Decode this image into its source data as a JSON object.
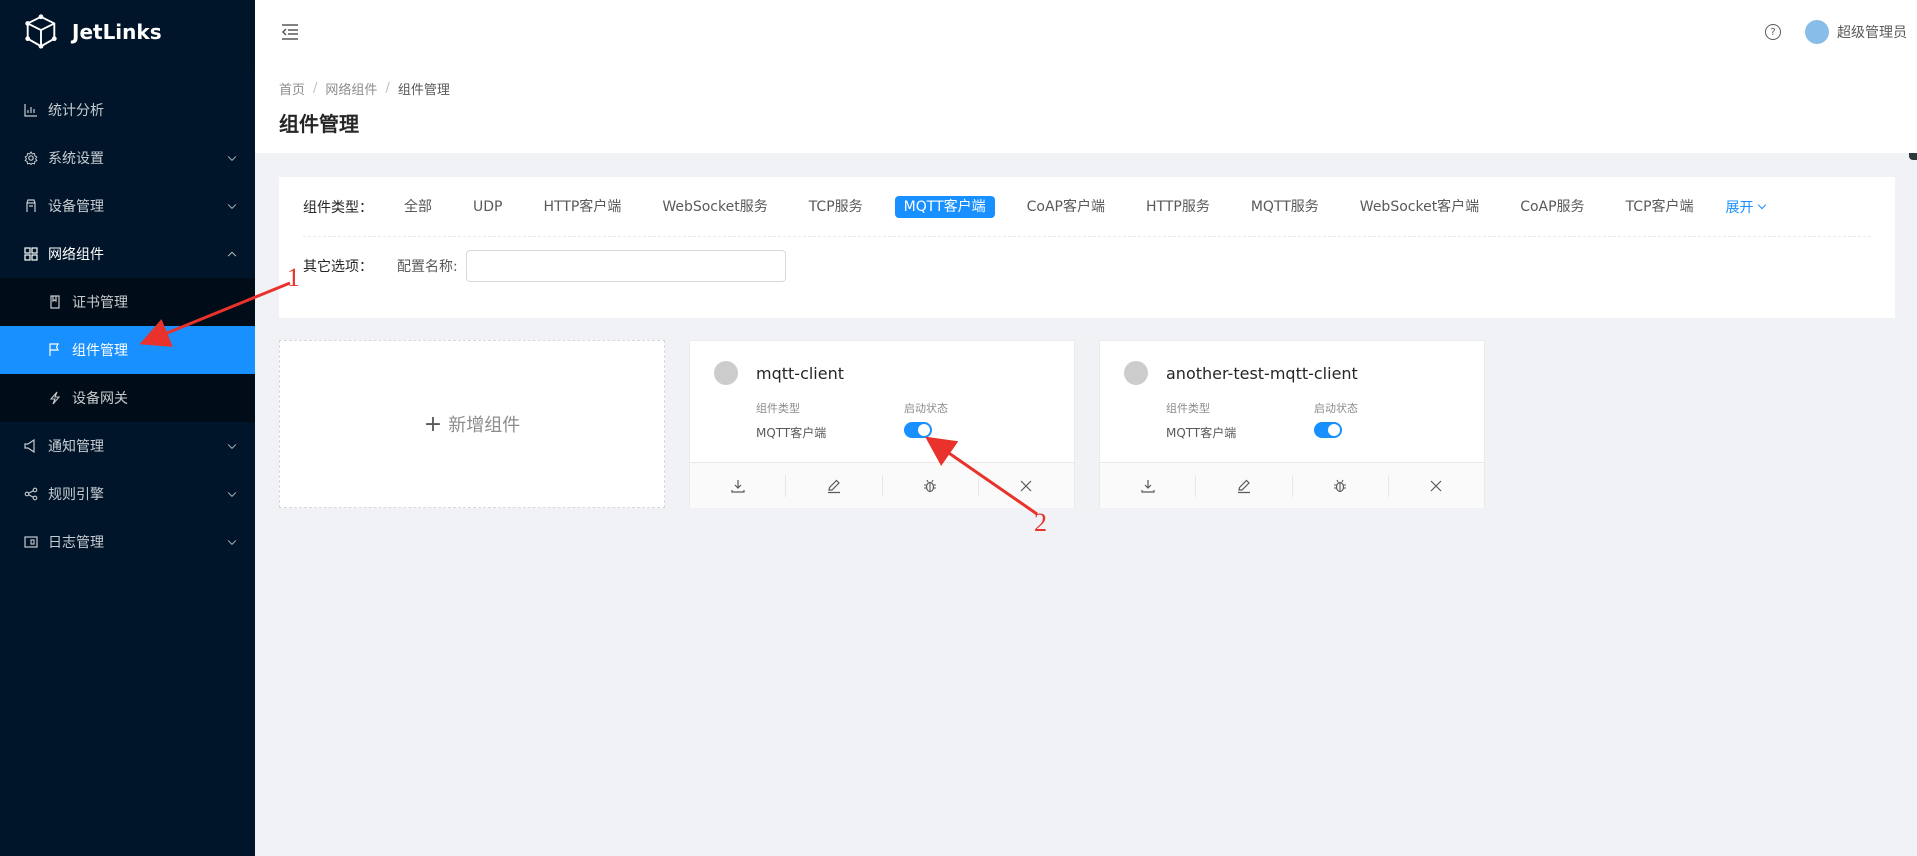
{
  "app": {
    "name": "JetLinks"
  },
  "sidebar": {
    "items": [
      {
        "label": "统计分析",
        "icon": "bar-chart-icon"
      },
      {
        "label": "系统设置",
        "icon": "gear-icon"
      },
      {
        "label": "设备管理",
        "icon": "device-icon"
      },
      {
        "label": "网络组件",
        "icon": "grid-icon"
      },
      {
        "label": "通知管理",
        "icon": "notification-icon"
      },
      {
        "label": "规则引擎",
        "icon": "share-icon"
      },
      {
        "label": "日志管理",
        "icon": "log-icon"
      }
    ],
    "submenu": [
      {
        "label": "证书管理",
        "icon": "file-icon"
      },
      {
        "label": "组件管理",
        "icon": "flag-icon",
        "active": true
      },
      {
        "label": "设备网关",
        "icon": "thunderbolt-icon"
      }
    ]
  },
  "header": {
    "username": "超级管理员",
    "help_glyph": "?"
  },
  "breadcrumb": {
    "home": "首页",
    "parent": "网络组件",
    "current": "组件管理",
    "separator": "/"
  },
  "page": {
    "title": "组件管理"
  },
  "filter": {
    "type_label": "组件类型：",
    "tags": [
      "全部",
      "UDP",
      "HTTP客户端",
      "WebSocket服务",
      "TCP服务",
      "MQTT客户端",
      "CoAP客户端",
      "HTTP服务",
      "MQTT服务",
      "WebSocket客户端",
      "CoAP服务",
      "TCP客户端"
    ],
    "active_tag": "MQTT客户端",
    "expand_label": "展开",
    "other_label": "其它选项：",
    "name_label": "配置名称:",
    "name_value": ""
  },
  "add_card": {
    "plus": "+",
    "label": "新增组件"
  },
  "cards": [
    {
      "title": "mqtt-client",
      "type_label": "组件类型",
      "type_value": "MQTT客户端",
      "status_label": "启动状态",
      "enabled": true
    },
    {
      "title": "another-test-mqtt-client",
      "type_label": "组件类型",
      "type_value": "MQTT客户端",
      "status_label": "启动状态",
      "enabled": true
    }
  ],
  "annotations": {
    "one": "1",
    "two": "2",
    "color": "#e8322b"
  },
  "colors": {
    "primary": "#1890ff",
    "sider": "#001529",
    "submenu": "#000c17"
  }
}
